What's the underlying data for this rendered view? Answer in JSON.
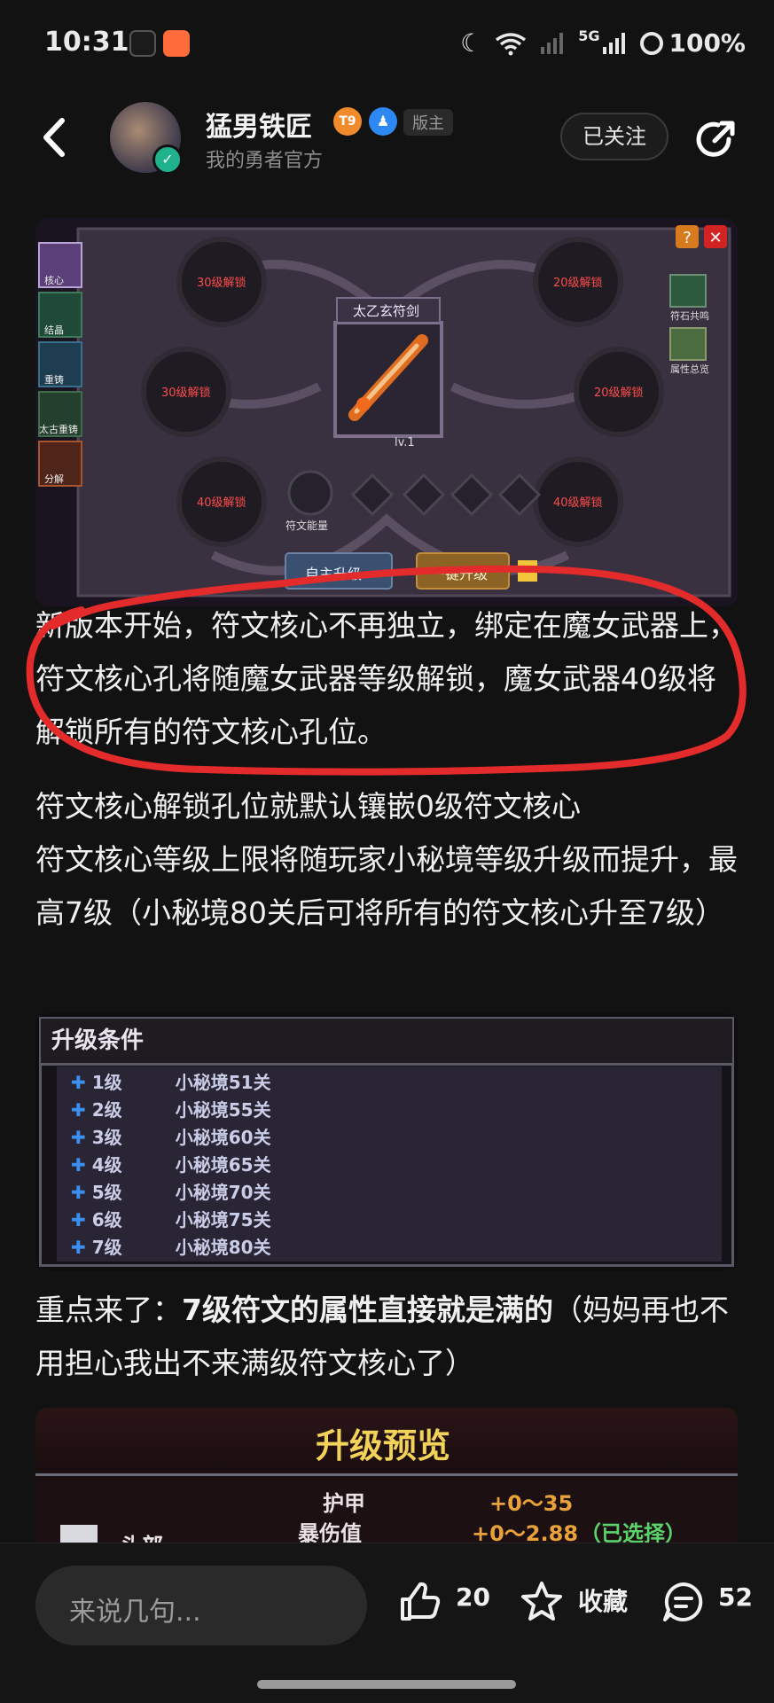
{
  "status_bar": {
    "time": "10:31",
    "network": "5G",
    "battery": "100%"
  },
  "author": {
    "name": "猛男铁匠",
    "level_badge": "T9",
    "role": "版主",
    "subtitle": "我的勇者官方",
    "follow_label": "已关注"
  },
  "image1": {
    "side_tabs": [
      "核心",
      "结晶",
      "重铸",
      "太古重铸",
      "分解"
    ],
    "slot_locks": [
      "30级解锁",
      "20级解锁",
      "30级解锁",
      "20级解锁",
      "40级解锁",
      "40级解锁"
    ],
    "weapon_name": "太乙玄符剑",
    "weapon_level": "lv.1",
    "energy_label": "符文能量",
    "right_top": "符石共鸣",
    "right_bottom": "属性总览",
    "btn_left": "自主升级",
    "btn_right": "一键升级"
  },
  "article": {
    "p1": "新版本开始，符文核心不再独立，绑定在魔女武器上，符文核心孔将随魔女武器等级解锁，魔女武器40级将解锁所有的符文核心孔位。",
    "p2": "符文核心解锁孔位就默认镶嵌0级符文核心",
    "p3": "符文核心等级上限将随玩家小秘境等级升级而提升，最高7级（小秘境80关后可将所有的符文核心升至7级）",
    "p4_prefix": "重点来了：",
    "p4_bold": "7级符文的属性直接就是满的",
    "p4_suffix": "（妈妈再也不用担心我出不来满级符文核心了）"
  },
  "image2": {
    "title": "升级条件",
    "rows": [
      {
        "level": "1级",
        "req": "小秘境51关"
      },
      {
        "level": "2级",
        "req": "小秘境55关"
      },
      {
        "level": "3级",
        "req": "小秘境60关"
      },
      {
        "level": "4级",
        "req": "小秘境65关"
      },
      {
        "level": "5级",
        "req": "小秘境70关"
      },
      {
        "level": "6级",
        "req": "小秘境75关"
      },
      {
        "level": "7级",
        "req": "小秘境80关"
      }
    ]
  },
  "image3": {
    "title": "升级预览",
    "stat1_name": "护甲",
    "stat1_val": "+0～35",
    "stat2_name": "暴伤值",
    "stat2_val": "+0～2.88",
    "stat2_note": "（已选择）",
    "partial": "头部"
  },
  "bottom_bar": {
    "comment_placeholder": "来说几句...",
    "likes": "20",
    "collect_label": "收藏",
    "comments": "52"
  }
}
